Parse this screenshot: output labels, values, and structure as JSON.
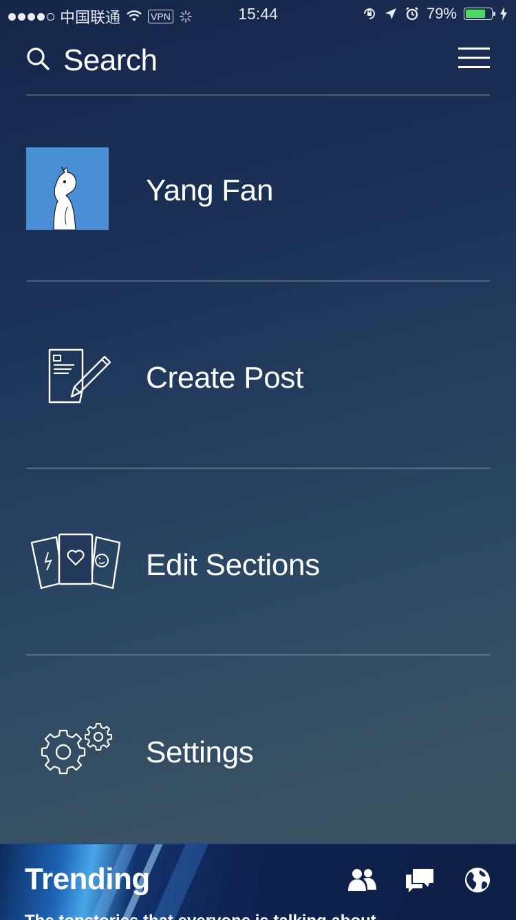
{
  "status_bar": {
    "carrier": "中国联通",
    "vpn": "VPN",
    "time": "15:44",
    "battery_percent": "79%",
    "battery_level": 0.79,
    "battery_color": "#4cd964"
  },
  "search": {
    "label": "Search"
  },
  "menu": [
    {
      "label": "Yang Fan",
      "icon": "avatar-moomin"
    },
    {
      "label": "Create Post",
      "icon": "create-post-icon"
    },
    {
      "label": "Edit Sections",
      "icon": "cards-icon"
    },
    {
      "label": "Settings",
      "icon": "gears-icon"
    }
  ],
  "trending": {
    "title": "Trending",
    "subtitle": "The topstories that everyone is talking about",
    "icons": [
      "people-icon",
      "chat-icon",
      "globe-icon"
    ]
  },
  "colors": {
    "background_top": "#15254a",
    "background_bottom": "#3c5260",
    "avatar_bg": "#4a8fd6"
  }
}
